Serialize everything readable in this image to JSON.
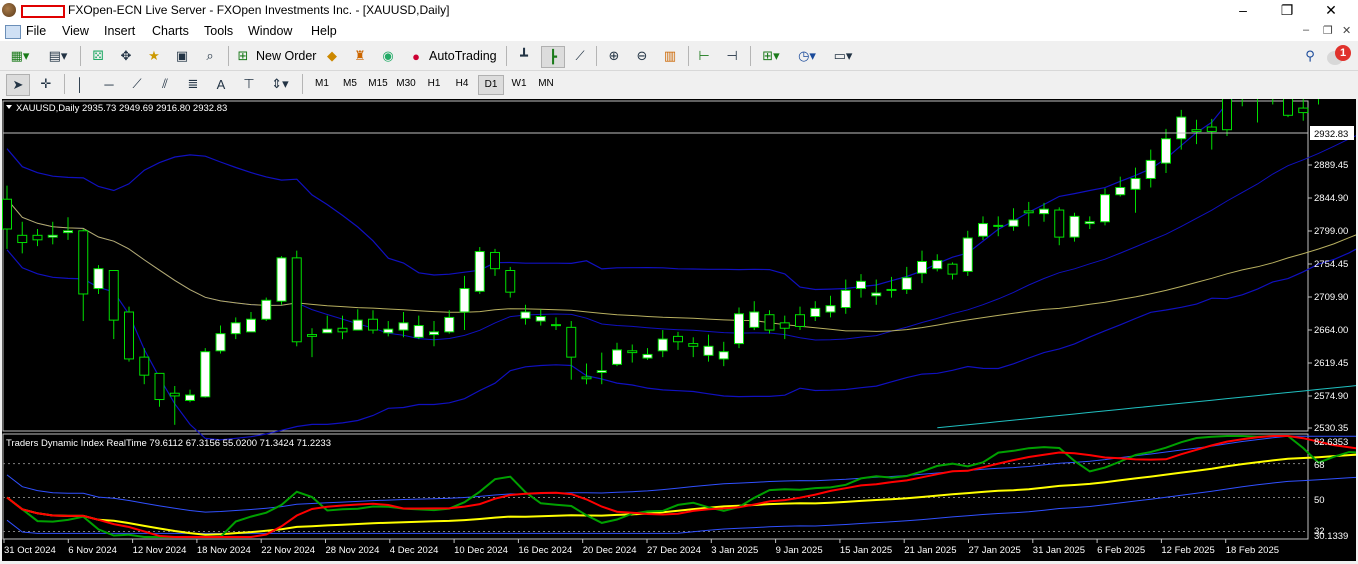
{
  "window": {
    "title": "FXOpen-ECN Live Server - FXOpen Investments Inc. - [XAUUSD,Daily]",
    "controls": [
      "–",
      "❐",
      "✕"
    ]
  },
  "menu": [
    "File",
    "View",
    "Insert",
    "Charts",
    "Tools",
    "Window",
    "Help"
  ],
  "toolbar": {
    "new_order": "New Order",
    "autotrading": "AutoTrading",
    "notification_count": "1",
    "timeframes": [
      "M1",
      "M5",
      "M15",
      "M30",
      "H1",
      "H4",
      "D1",
      "W1",
      "MN"
    ],
    "active_timeframe": "D1"
  },
  "chart": {
    "header": "XAUUSD,Daily  2935.73 2949.69 2916.80 2932.83",
    "current_price": "2932.83",
    "price_ticks": [
      "2889.45",
      "2844.90",
      "2799.00",
      "2754.45",
      "2709.90",
      "2664.00",
      "2619.45",
      "2574.90",
      "2530.35"
    ],
    "date_ticks": [
      "31 Oct 2024",
      "6 Nov 2024",
      "12 Nov 2024",
      "18 Nov 2024",
      "22 Nov 2024",
      "28 Nov 2024",
      "4 Dec 2024",
      "10 Dec 2024",
      "16 Dec 2024",
      "20 Dec 2024",
      "27 Dec 2024",
      "3 Jan 2025",
      "9 Jan 2025",
      "15 Jan 2025",
      "21 Jan 2025",
      "27 Jan 2025",
      "31 Jan 2025",
      "6 Feb 2025",
      "12 Feb 2025",
      "18 Feb 2025"
    ],
    "indicator_header": "Traders Dynamic Index RealTime 79.6112 67.3156 55.0200 71.3424 71.2233",
    "indicator_ticks": [
      "82.6353",
      "68",
      "50",
      "32",
      "30.1339"
    ],
    "colors": {
      "bull": "#ffffff",
      "bear": "#ffffff",
      "wick": "#00e000",
      "bb": "#1010c0",
      "ma": "#b8b060",
      "tdi_green": "#00a000",
      "tdi_red": "#ff0000",
      "tdi_yellow": "#ffff00",
      "tdi_band": "#3050ff"
    }
  },
  "chart_data": {
    "type": "candlestick",
    "symbol": "XAUUSD",
    "timeframe": "Daily",
    "ylim": [
      2530.35,
      2960
    ],
    "candles": [
      [
        2752,
        2800,
        2730,
        2785
      ],
      [
        2737,
        2760,
        2725,
        2745
      ],
      [
        2740,
        2752,
        2733,
        2745
      ],
      [
        2745,
        2760,
        2735,
        2743
      ],
      [
        2750,
        2765,
        2740,
        2748
      ],
      [
        2680,
        2752,
        2650,
        2750
      ],
      [
        2708,
        2712,
        2680,
        2686
      ],
      [
        2651,
        2700,
        2630,
        2706
      ],
      [
        2608,
        2666,
        2605,
        2660
      ],
      [
        2590,
        2620,
        2580,
        2610
      ],
      [
        2563,
        2590,
        2555,
        2592
      ],
      [
        2567,
        2578,
        2535,
        2570
      ],
      [
        2568,
        2574,
        2560,
        2562
      ],
      [
        2616,
        2620,
        2565,
        2566
      ],
      [
        2636,
        2645,
        2614,
        2617
      ],
      [
        2648,
        2654,
        2630,
        2636
      ],
      [
        2652,
        2660,
        2640,
        2638
      ],
      [
        2673,
        2676,
        2650,
        2652
      ],
      [
        2720,
        2722,
        2668,
        2672
      ],
      [
        2627,
        2728,
        2622,
        2720
      ],
      [
        2633,
        2642,
        2610,
        2635
      ],
      [
        2641,
        2656,
        2637,
        2637
      ],
      [
        2638,
        2656,
        2630,
        2642
      ],
      [
        2651,
        2663,
        2640,
        2640
      ],
      [
        2640,
        2662,
        2636,
        2652
      ],
      [
        2641,
        2650,
        2633,
        2637
      ],
      [
        2648,
        2660,
        2632,
        2640
      ],
      [
        2645,
        2656,
        2630,
        2632
      ],
      [
        2638,
        2650,
        2622,
        2635
      ],
      [
        2654,
        2662,
        2636,
        2638
      ],
      [
        2686,
        2700,
        2640,
        2660
      ],
      [
        2727,
        2732,
        2680,
        2683
      ],
      [
        2708,
        2730,
        2700,
        2726
      ],
      [
        2682,
        2710,
        2676,
        2706
      ],
      [
        2660,
        2668,
        2646,
        2653
      ],
      [
        2655,
        2663,
        2645,
        2650
      ],
      [
        2646,
        2654,
        2640,
        2645
      ],
      [
        2610,
        2650,
        2585,
        2643
      ],
      [
        2586,
        2603,
        2580,
        2588
      ],
      [
        2595,
        2615,
        2580,
        2593
      ],
      [
        2618,
        2626,
        2600,
        2602
      ],
      [
        2615,
        2624,
        2604,
        2617
      ],
      [
        2613,
        2620,
        2607,
        2609
      ],
      [
        2630,
        2640,
        2610,
        2617
      ],
      [
        2627,
        2638,
        2618,
        2633
      ],
      [
        2622,
        2632,
        2610,
        2625
      ],
      [
        2622,
        2635,
        2605,
        2612
      ],
      [
        2616,
        2627,
        2600,
        2608
      ],
      [
        2658,
        2665,
        2620,
        2625
      ],
      [
        2660,
        2672,
        2640,
        2643
      ],
      [
        2640,
        2662,
        2636,
        2657
      ],
      [
        2642,
        2656,
        2630,
        2648
      ],
      [
        2644,
        2666,
        2640,
        2657
      ],
      [
        2664,
        2672,
        2650,
        2655
      ],
      [
        2667,
        2678,
        2654,
        2660
      ],
      [
        2684,
        2696,
        2658,
        2665
      ],
      [
        2694,
        2702,
        2676,
        2686
      ],
      [
        2681,
        2696,
        2668,
        2678
      ],
      [
        2685,
        2699,
        2676,
        2684
      ],
      [
        2698,
        2710,
        2680,
        2685
      ],
      [
        2716,
        2728,
        2692,
        2703
      ],
      [
        2717,
        2724,
        2705,
        2708
      ],
      [
        2702,
        2715,
        2696,
        2713
      ],
      [
        2742,
        2750,
        2700,
        2705
      ],
      [
        2758,
        2766,
        2740,
        2744
      ],
      [
        2756,
        2766,
        2744,
        2755
      ],
      [
        2762,
        2775,
        2750,
        2755
      ],
      [
        2770,
        2782,
        2755,
        2772
      ],
      [
        2774,
        2781,
        2760,
        2769
      ],
      [
        2743,
        2776,
        2734,
        2773
      ],
      [
        2766,
        2770,
        2738,
        2743
      ],
      [
        2760,
        2766,
        2752,
        2758
      ],
      [
        2790,
        2797,
        2756,
        2760
      ],
      [
        2798,
        2810,
        2788,
        2790
      ],
      [
        2808,
        2820,
        2770,
        2796
      ],
      [
        2828,
        2840,
        2798,
        2808
      ],
      [
        2852,
        2863,
        2814,
        2825
      ],
      [
        2876,
        2884,
        2840,
        2852
      ],
      [
        2860,
        2873,
        2846,
        2862
      ],
      [
        2860,
        2874,
        2840,
        2865
      ],
      [
        2862,
        2940,
        2855,
        2907
      ],
      [
        2905,
        2922,
        2888,
        2898
      ],
      [
        2908,
        2918,
        2870,
        2900
      ],
      [
        2902,
        2930,
        2890,
        2926
      ],
      [
        2878,
        2934,
        2876,
        2928
      ],
      [
        2881,
        2900,
        2872,
        2886
      ],
      [
        2932,
        2937,
        2890,
        2898
      ],
      [
        2928,
        2938,
        2916,
        2929
      ],
      [
        2930,
        2948,
        2920,
        2933
      ],
      [
        2935,
        2942,
        2922,
        2930
      ],
      [
        2935,
        2950,
        2917,
        2933
      ]
    ]
  }
}
